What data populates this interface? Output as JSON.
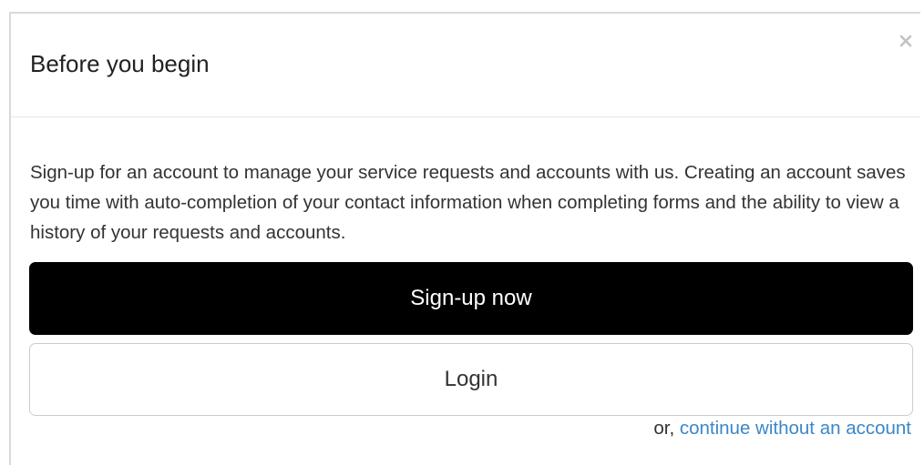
{
  "dialog": {
    "title": "Before you begin",
    "close_icon": "close-icon",
    "description": "Sign-up for an account to manage your service requests and accounts with us. Creating an account saves you time with auto-completion of your contact information when completing forms and the ability to view a history of your requests and accounts.",
    "signup_label": "Sign-up now",
    "login_label": "Login",
    "continue_prefix": "or, ",
    "continue_link": "continue without an account"
  },
  "colors": {
    "primary_button": "#000000",
    "link": "#3a87c8",
    "border": "#d9d9d9"
  }
}
